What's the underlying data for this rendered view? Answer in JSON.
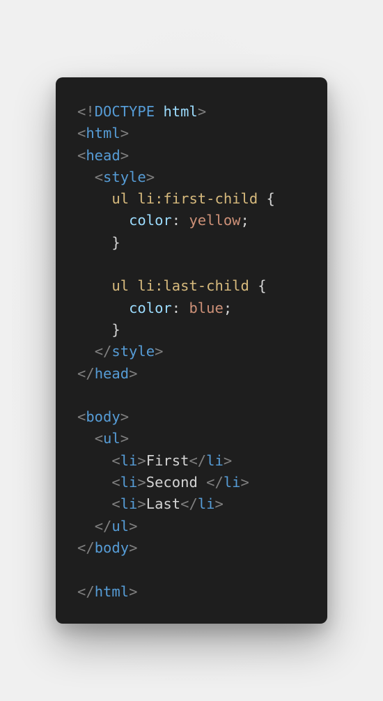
{
  "colors": {
    "page_background": "#f0f0f0",
    "editor_background": "#1e1e1e",
    "punctuation": "#808080",
    "tag": "#569cd6",
    "doctype_keyword": "#9cdcfe",
    "css_selector": "#d7ba7d",
    "css_property": "#9cdcfe",
    "css_value": "#ce9178",
    "plain_text": "#d4d4d4"
  },
  "code": {
    "lines": [
      [
        {
          "t": "punct",
          "v": "<!"
        },
        {
          "t": "tag",
          "v": "DOCTYPE"
        },
        {
          "t": "text",
          "v": " "
        },
        {
          "t": "attr",
          "v": "html"
        },
        {
          "t": "punct",
          "v": ">"
        }
      ],
      [
        {
          "t": "punct",
          "v": "<"
        },
        {
          "t": "tag",
          "v": "html"
        },
        {
          "t": "punct",
          "v": ">"
        }
      ],
      [
        {
          "t": "punct",
          "v": "<"
        },
        {
          "t": "tag",
          "v": "head"
        },
        {
          "t": "punct",
          "v": ">"
        }
      ],
      [
        {
          "t": "text",
          "v": "  "
        },
        {
          "t": "punct",
          "v": "<"
        },
        {
          "t": "tag",
          "v": "style"
        },
        {
          "t": "punct",
          "v": ">"
        }
      ],
      [
        {
          "t": "text",
          "v": "    "
        },
        {
          "t": "selector",
          "v": "ul li:first-child"
        },
        {
          "t": "text",
          "v": " "
        },
        {
          "t": "brace",
          "v": "{"
        }
      ],
      [
        {
          "t": "text",
          "v": "      "
        },
        {
          "t": "prop",
          "v": "color"
        },
        {
          "t": "brace",
          "v": ": "
        },
        {
          "t": "value",
          "v": "yellow"
        },
        {
          "t": "brace",
          "v": ";"
        }
      ],
      [
        {
          "t": "text",
          "v": "    "
        },
        {
          "t": "brace",
          "v": "}"
        }
      ],
      [],
      [
        {
          "t": "text",
          "v": "    "
        },
        {
          "t": "selector",
          "v": "ul li:last-child"
        },
        {
          "t": "text",
          "v": " "
        },
        {
          "t": "brace",
          "v": "{"
        }
      ],
      [
        {
          "t": "text",
          "v": "      "
        },
        {
          "t": "prop",
          "v": "color"
        },
        {
          "t": "brace",
          "v": ": "
        },
        {
          "t": "value",
          "v": "blue"
        },
        {
          "t": "brace",
          "v": ";"
        }
      ],
      [
        {
          "t": "text",
          "v": "    "
        },
        {
          "t": "brace",
          "v": "}"
        }
      ],
      [
        {
          "t": "text",
          "v": "  "
        },
        {
          "t": "punct",
          "v": "</"
        },
        {
          "t": "tag",
          "v": "style"
        },
        {
          "t": "punct",
          "v": ">"
        }
      ],
      [
        {
          "t": "punct",
          "v": "</"
        },
        {
          "t": "tag",
          "v": "head"
        },
        {
          "t": "punct",
          "v": ">"
        }
      ],
      [],
      [
        {
          "t": "punct",
          "v": "<"
        },
        {
          "t": "tag",
          "v": "body"
        },
        {
          "t": "punct",
          "v": ">"
        }
      ],
      [
        {
          "t": "text",
          "v": "  "
        },
        {
          "t": "punct",
          "v": "<"
        },
        {
          "t": "tag",
          "v": "ul"
        },
        {
          "t": "punct",
          "v": ">"
        }
      ],
      [
        {
          "t": "text",
          "v": "    "
        },
        {
          "t": "punct",
          "v": "<"
        },
        {
          "t": "tag",
          "v": "li"
        },
        {
          "t": "punct",
          "v": ">"
        },
        {
          "t": "text",
          "v": "First"
        },
        {
          "t": "punct",
          "v": "</"
        },
        {
          "t": "tag",
          "v": "li"
        },
        {
          "t": "punct",
          "v": ">"
        }
      ],
      [
        {
          "t": "text",
          "v": "    "
        },
        {
          "t": "punct",
          "v": "<"
        },
        {
          "t": "tag",
          "v": "li"
        },
        {
          "t": "punct",
          "v": ">"
        },
        {
          "t": "text",
          "v": "Second "
        },
        {
          "t": "punct",
          "v": "</"
        },
        {
          "t": "tag",
          "v": "li"
        },
        {
          "t": "punct",
          "v": ">"
        }
      ],
      [
        {
          "t": "text",
          "v": "    "
        },
        {
          "t": "punct",
          "v": "<"
        },
        {
          "t": "tag",
          "v": "li"
        },
        {
          "t": "punct",
          "v": ">"
        },
        {
          "t": "text",
          "v": "Last"
        },
        {
          "t": "punct",
          "v": "</"
        },
        {
          "t": "tag",
          "v": "li"
        },
        {
          "t": "punct",
          "v": ">"
        }
      ],
      [
        {
          "t": "text",
          "v": "  "
        },
        {
          "t": "punct",
          "v": "</"
        },
        {
          "t": "tag",
          "v": "ul"
        },
        {
          "t": "punct",
          "v": ">"
        }
      ],
      [
        {
          "t": "punct",
          "v": "</"
        },
        {
          "t": "tag",
          "v": "body"
        },
        {
          "t": "punct",
          "v": ">"
        }
      ],
      [],
      [
        {
          "t": "punct",
          "v": "</"
        },
        {
          "t": "tag",
          "v": "html"
        },
        {
          "t": "punct",
          "v": ">"
        }
      ]
    ]
  }
}
